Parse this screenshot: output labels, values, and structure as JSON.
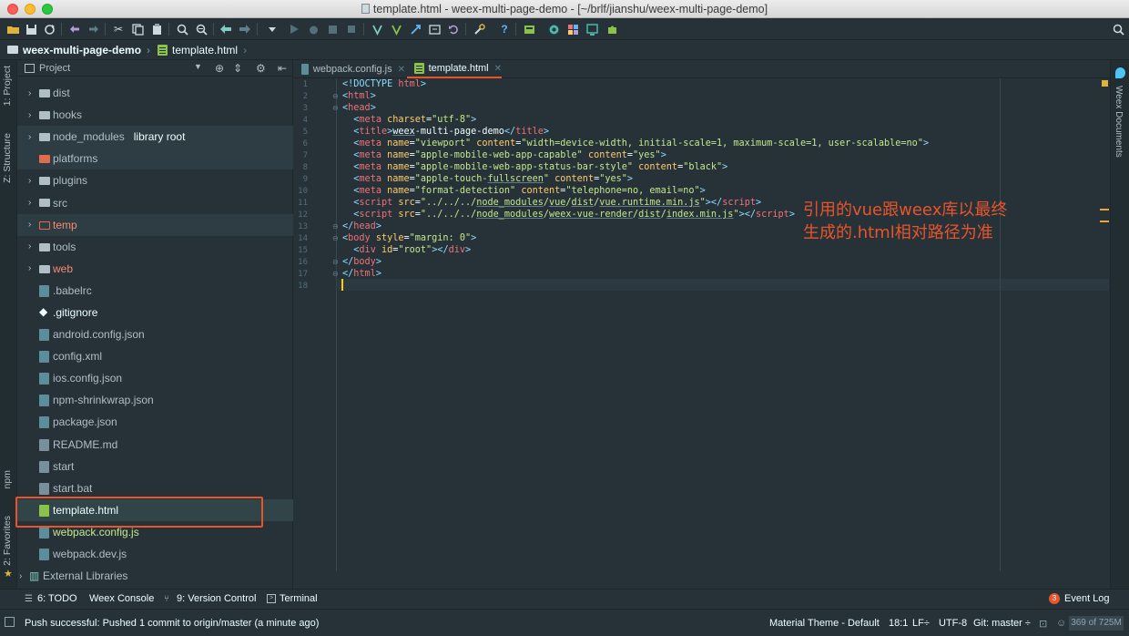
{
  "window": {
    "title": "template.html - weex-multi-page-demo - [~/brlf/jianshu/weex-multi-page-demo]"
  },
  "breadcrumb": {
    "project": "weex-multi-page-demo",
    "file": "template.html"
  },
  "left_strip": {
    "project_tab": "1: Project",
    "structure_tab": "Z: Structure",
    "npm_tab": "npm",
    "favorites_tab": "2: Favorites"
  },
  "project_panel": {
    "view_selector": "Project",
    "items": [
      {
        "label": "dist",
        "kind": "folder"
      },
      {
        "label": "hooks",
        "kind": "folder"
      },
      {
        "label": "node_modules",
        "kind": "folder",
        "tag": "library root"
      },
      {
        "label": "platforms",
        "kind": "folder"
      },
      {
        "label": "plugins",
        "kind": "folder"
      },
      {
        "label": "src",
        "kind": "folder"
      },
      {
        "label": "temp",
        "kind": "folder"
      },
      {
        "label": "tools",
        "kind": "folder"
      },
      {
        "label": "web",
        "kind": "folder"
      },
      {
        "label": ".babelrc",
        "kind": "file"
      },
      {
        "label": ".gitignore",
        "kind": "file"
      },
      {
        "label": "android.config.json",
        "kind": "file"
      },
      {
        "label": "config.xml",
        "kind": "file"
      },
      {
        "label": "ios.config.json",
        "kind": "file"
      },
      {
        "label": "npm-shrinkwrap.json",
        "kind": "file"
      },
      {
        "label": "package.json",
        "kind": "file"
      },
      {
        "label": "README.md",
        "kind": "file"
      },
      {
        "label": "start",
        "kind": "file"
      },
      {
        "label": "start.bat",
        "kind": "file"
      },
      {
        "label": "template.html",
        "kind": "file"
      },
      {
        "label": "webpack.config.js",
        "kind": "file"
      },
      {
        "label": "webpack.dev.js",
        "kind": "file"
      },
      {
        "label": "External Libraries",
        "kind": "library"
      }
    ]
  },
  "editor": {
    "tabs": [
      {
        "label": "webpack.config.js",
        "active": false
      },
      {
        "label": "template.html",
        "active": true
      }
    ],
    "line_numbers": [
      "1",
      "2",
      "3",
      "4",
      "5",
      "6",
      "7",
      "8",
      "9",
      "10",
      "11",
      "12",
      "13",
      "14",
      "15",
      "16",
      "17",
      "18"
    ],
    "annotation_lines": [
      "引用的vue跟weex库以最终",
      "生成的.html相对路径为准"
    ]
  },
  "right_strip": {
    "weex_documents": "Weex Documents"
  },
  "tool_windows": {
    "todo": "6: TODO",
    "weex_console": "Weex Console",
    "version_control": "9: Version Control",
    "terminal": "Terminal",
    "event_log": "Event Log",
    "event_log_count": "3"
  },
  "status_bar": {
    "message": "Push successful: Pushed 1 commit to origin/master (a minute ago)",
    "theme": "Material Theme - Default",
    "position": "18:1",
    "line_sep": "LF÷",
    "encoding": "UTF-8",
    "vcs": "Git: master ÷",
    "memory": "369 of 725M"
  },
  "colors": {
    "background": "#263238",
    "accent": "#e8542c",
    "tag": "#f07178",
    "attr": "#ffcb6b",
    "string": "#c3e88d"
  }
}
